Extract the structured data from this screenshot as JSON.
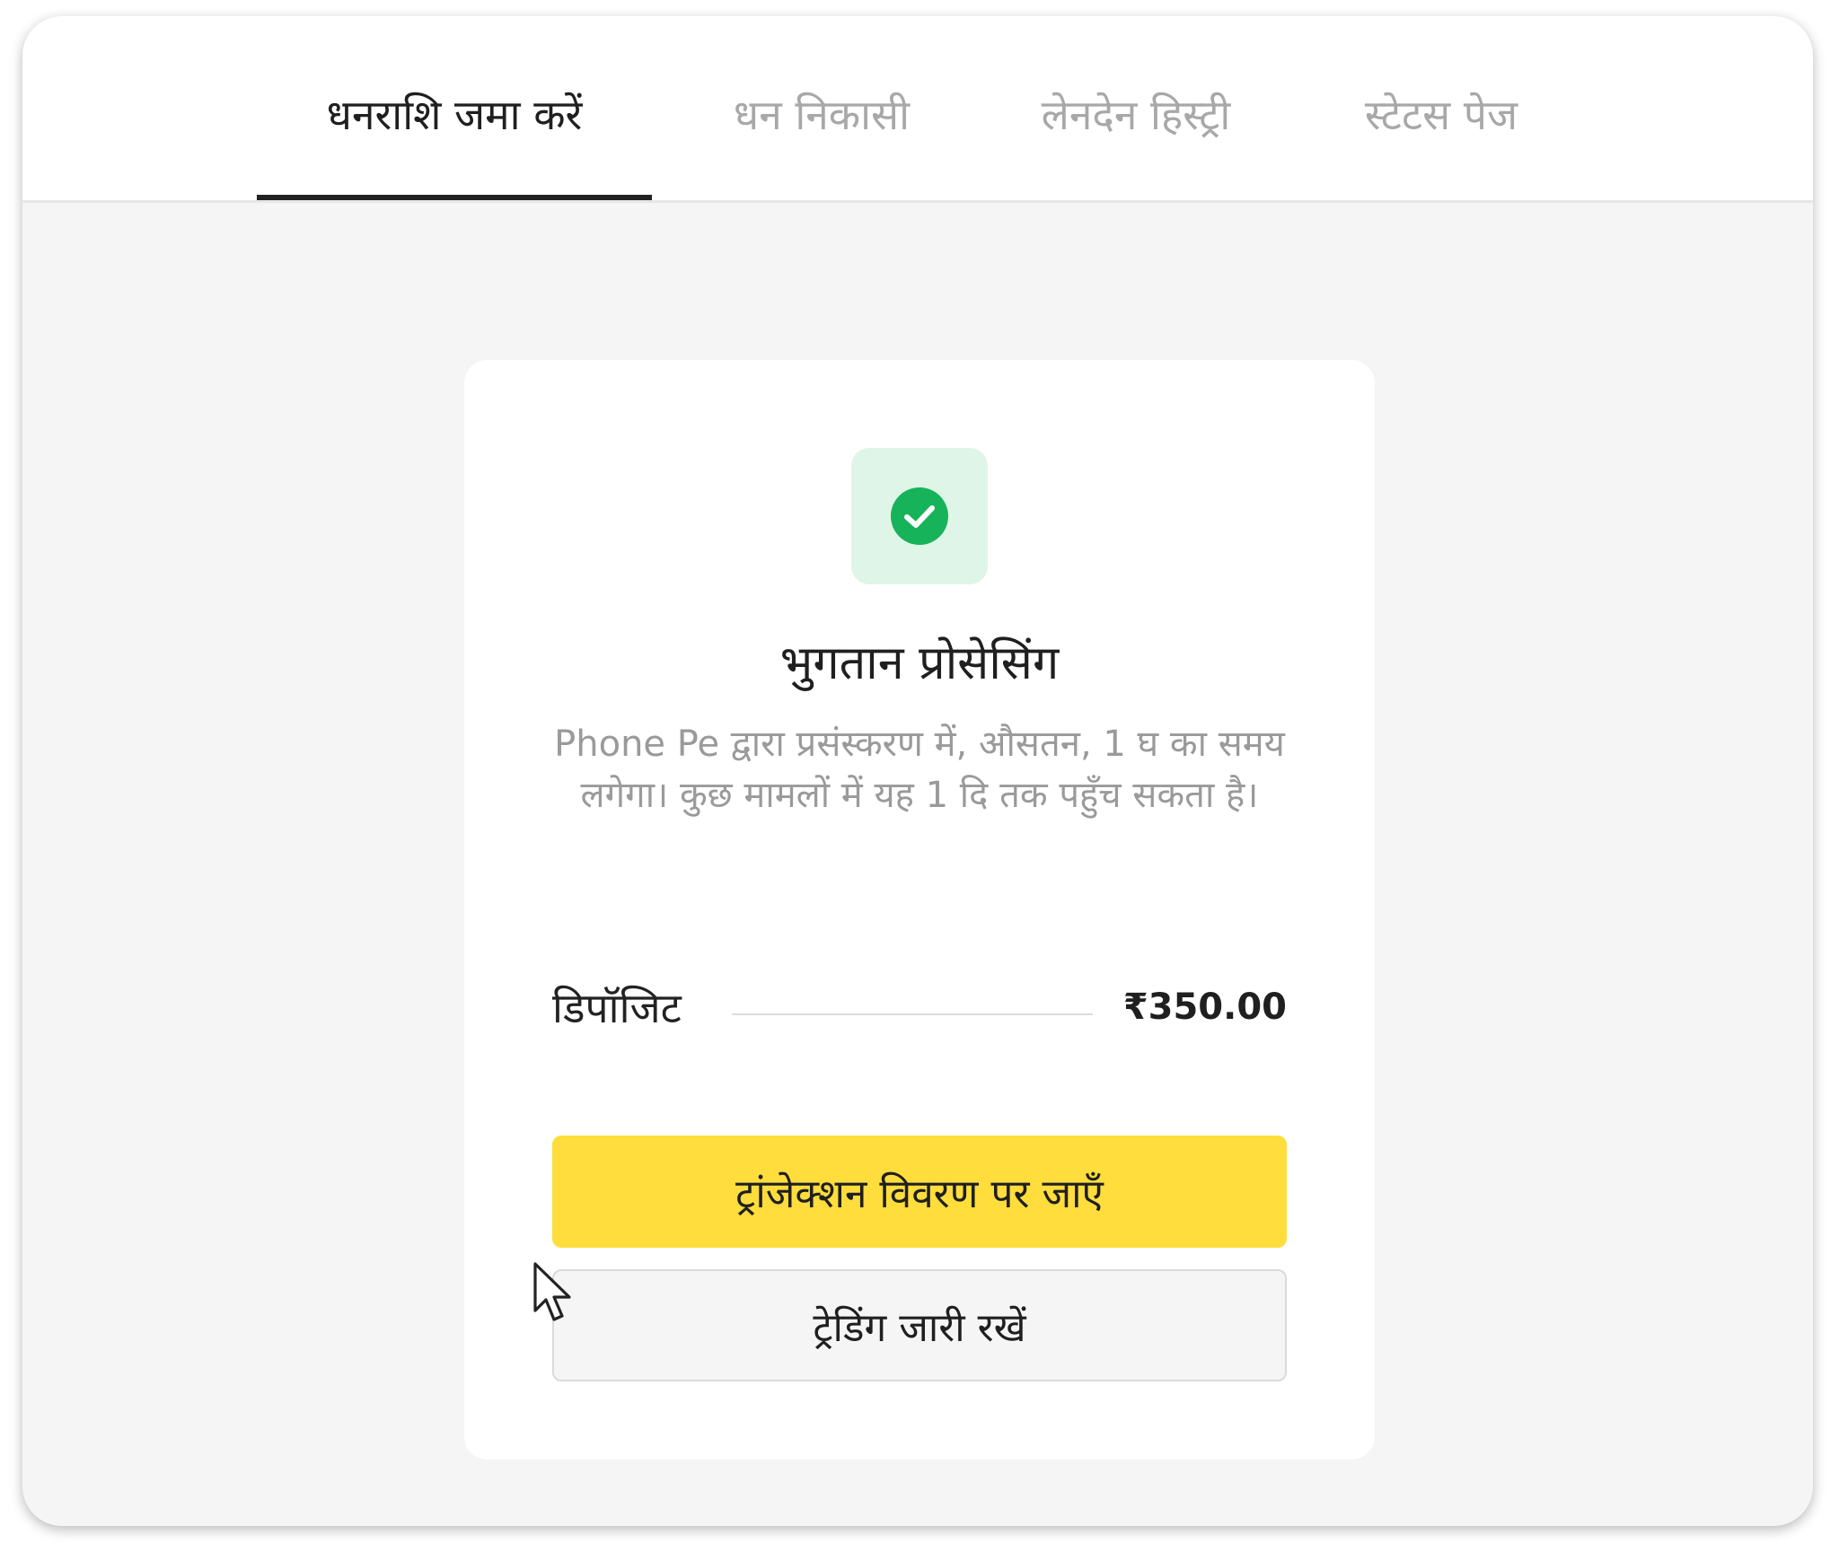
{
  "tabs": [
    {
      "label": "धनराशि जमा करें",
      "active": true
    },
    {
      "label": "धन निकासी",
      "active": false
    },
    {
      "label": "लेनदेन हिस्ट्री",
      "active": false
    },
    {
      "label": "स्टेटस पेज",
      "active": false
    }
  ],
  "status": {
    "icon": "check-circle-icon",
    "icon_color": "#17b35a",
    "tile_color": "#dff5e8",
    "title": "भुगतान प्रोसेसिंग",
    "description": "Phone Pe द्वारा प्रसंस्करण में, औसतन, 1 घ का समय लगेगा। कुछ मामलों में यह 1 दि तक पहुँच सकता है।"
  },
  "deposit": {
    "label": "डिपॉजिट",
    "amount": "₹350.00"
  },
  "buttons": {
    "primary": "ट्रांजेक्शन विवरण पर जाएँ",
    "secondary": "ट्रेडिंग जारी रखें"
  },
  "colors": {
    "accent": "#ffdd3c",
    "success": "#17b35a"
  }
}
